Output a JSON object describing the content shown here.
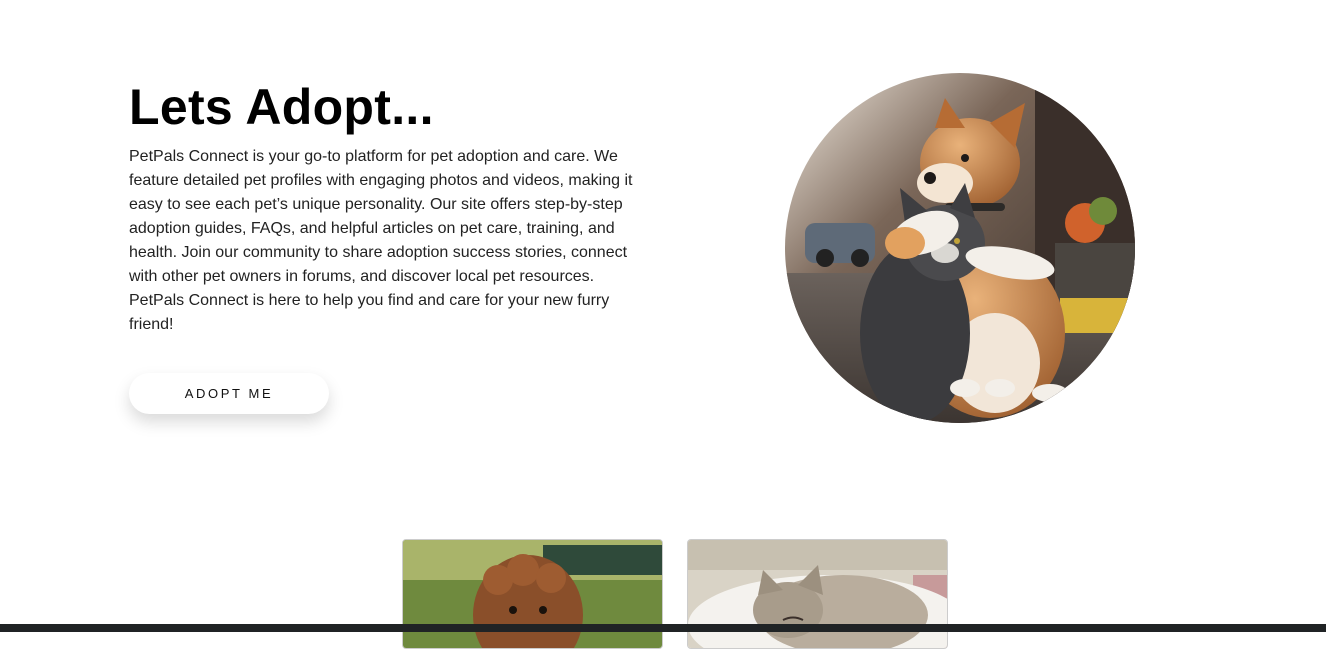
{
  "hero": {
    "title": "Lets Adopt...",
    "description": "PetPals Connect is your go-to platform for pet adoption and care. We feature detailed pet profiles with engaging photos and videos, making it easy to see each pet’s unique personality. Our site offers step-by-step adoption guides, FAQs, and helpful articles on pet care, training, and health. Join our community to share adoption success stories, connect with other pet owners in forums, and discover local pet resources. PetPals Connect is here to help you find and care for your new furry friend!",
    "button_label": "ADOPT ME",
    "image": "dog-hugging-cat-photo"
  },
  "cards": [
    {
      "image": "curly-dog-photo"
    },
    {
      "image": "cat-on-pillow-photo"
    }
  ],
  "colors": {
    "background": "#ffffff",
    "title": "#000000",
    "text": "#222222",
    "taskbar": "#202325"
  }
}
